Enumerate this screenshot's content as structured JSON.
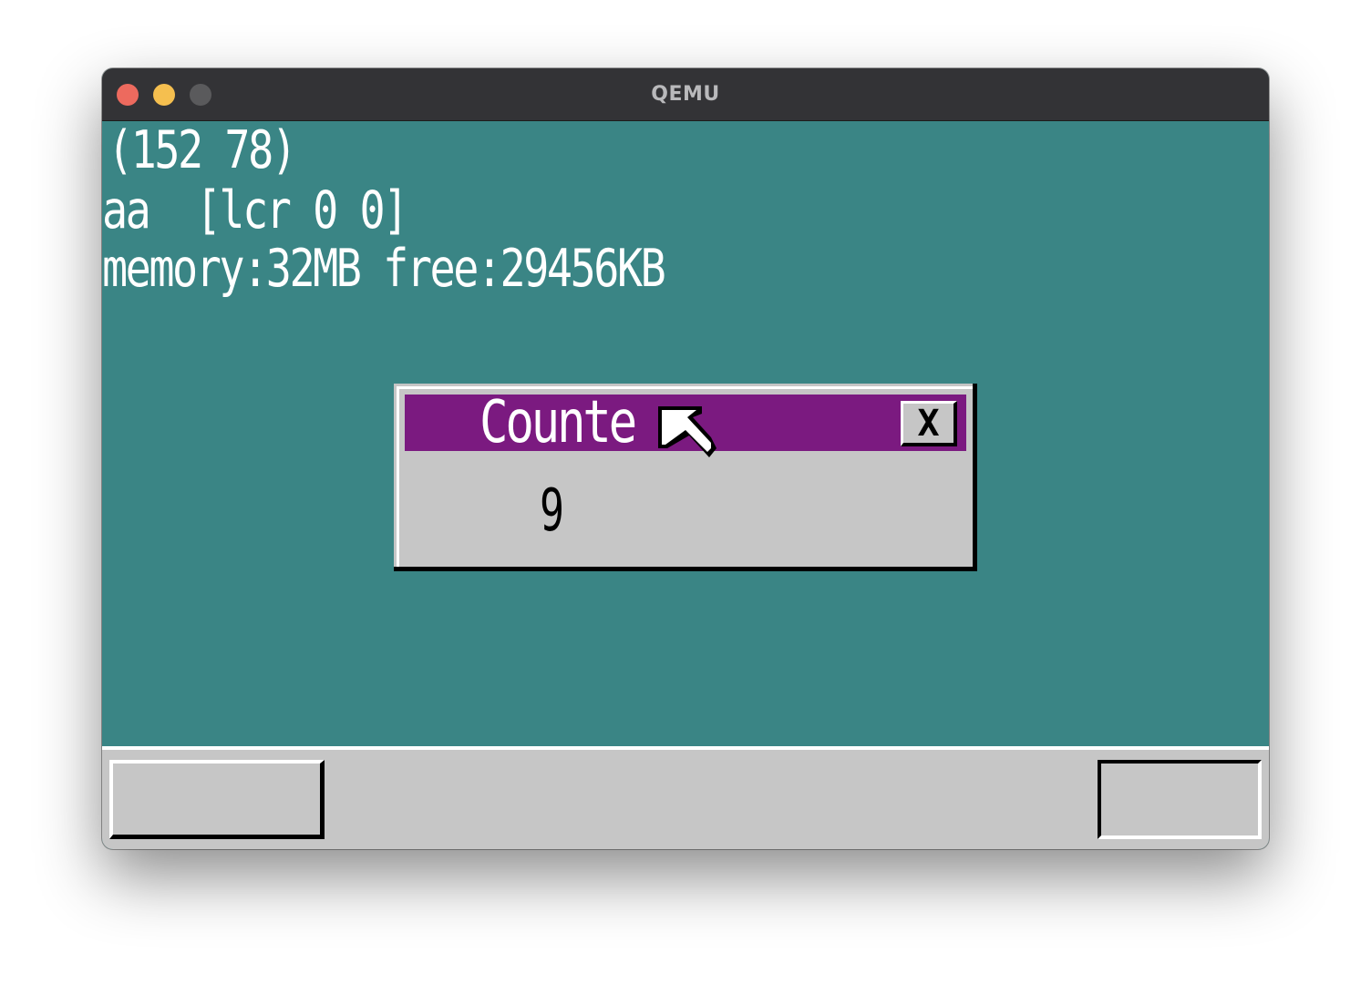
{
  "window": {
    "title": "QEMU",
    "buttons": {
      "close_color": "#ed6a5e",
      "minimize_color": "#f5bf4f",
      "zoom_color": "#5a5a5c"
    }
  },
  "desktop": {
    "background_color": "#3a8585",
    "console_lines": {
      "coords": "(152 78)",
      "keys": "aa  [lcr 0 0]",
      "memory": "memory:32MB free:29456KB"
    }
  },
  "counter_window": {
    "title": "Counte",
    "close_label": "X",
    "value": "9",
    "titlebar_color": "#7b1a80"
  },
  "cursor": {
    "icon": "mouse-pointer-arrow-icon"
  },
  "taskbar": {
    "color": "#c6c6c6"
  }
}
